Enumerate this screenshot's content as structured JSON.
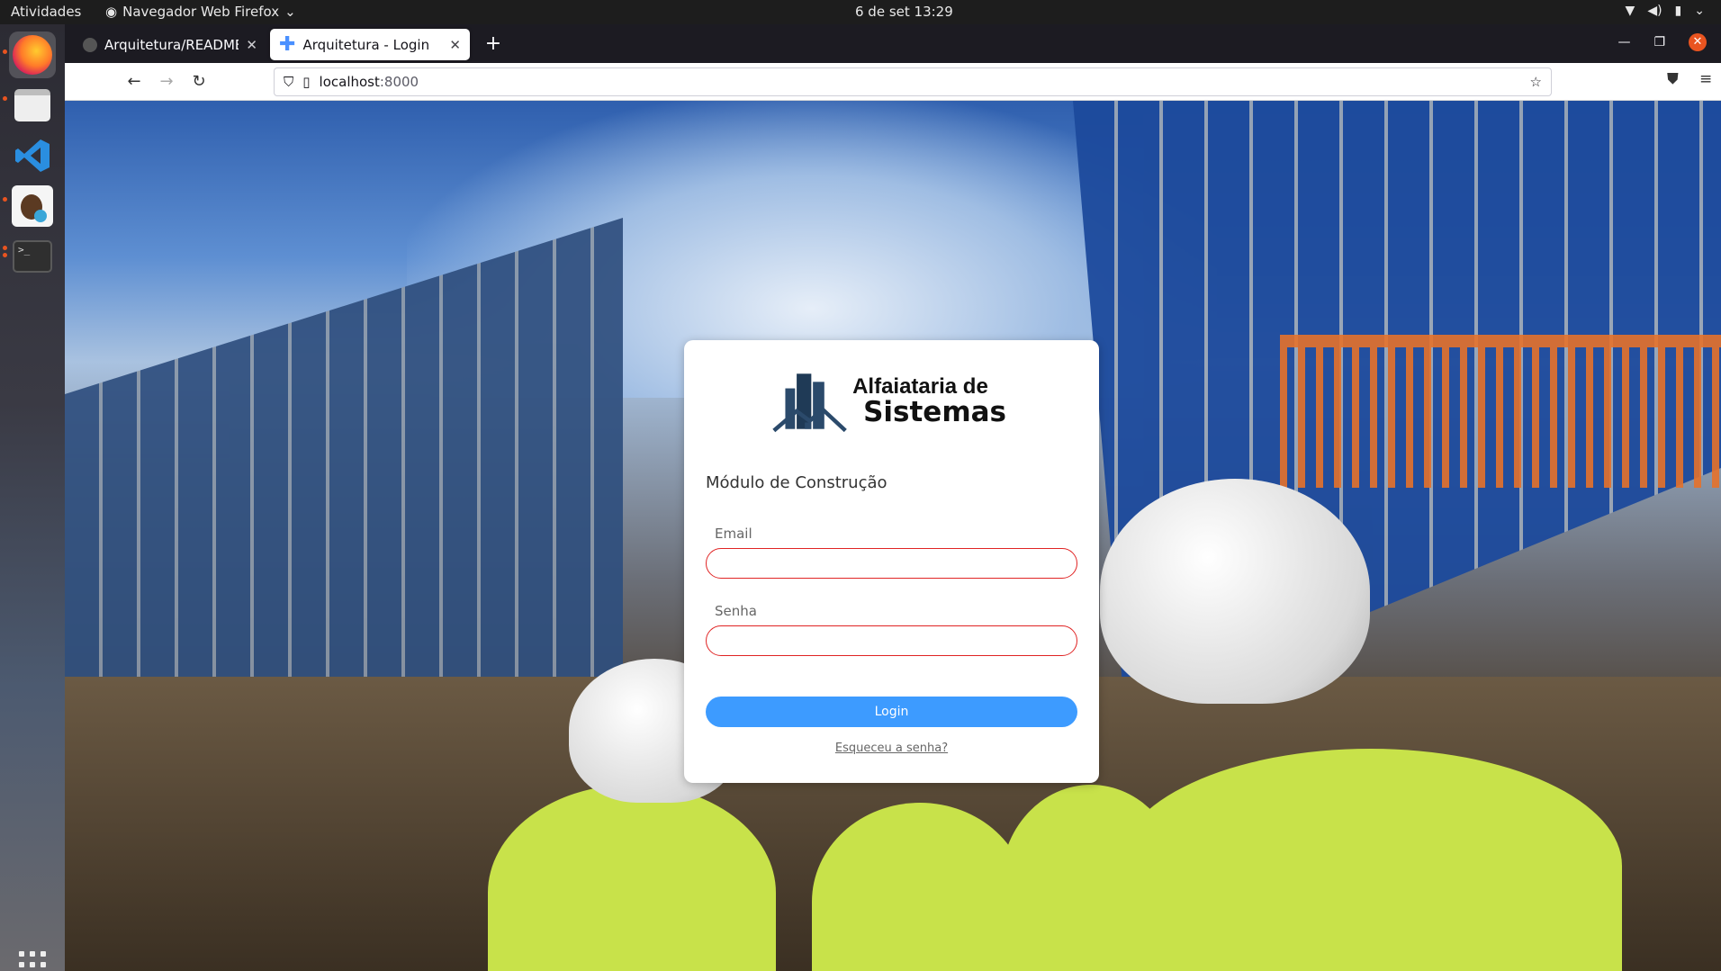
{
  "system": {
    "activities": "Atividades",
    "app_menu": "Navegador Web Firefox",
    "clock": "6 de set  13:29"
  },
  "dock": {
    "apps": [
      "firefox-icon",
      "files-icon",
      "vscode-icon",
      "dbeaver-icon",
      "terminal-icon"
    ]
  },
  "browser": {
    "tabs": [
      {
        "title": "Arquitetura/README.md",
        "active": false
      },
      {
        "title": "Arquitetura - Login",
        "active": true
      }
    ],
    "url_host": "localhost",
    "url_port": ":8000"
  },
  "login": {
    "brand_line1": "Alfaiataria de",
    "brand_line2": "Sistemas",
    "module_title": "Módulo de Construção",
    "email_label": "Email",
    "email_value": "",
    "password_label": "Senha",
    "password_value": "",
    "login_button": "Login",
    "forgot_link": "Esqueceu a senha?"
  },
  "colors": {
    "button": "#3d9bff",
    "input_border_error": "#e02424",
    "ubuntu_accent": "#e95420"
  }
}
